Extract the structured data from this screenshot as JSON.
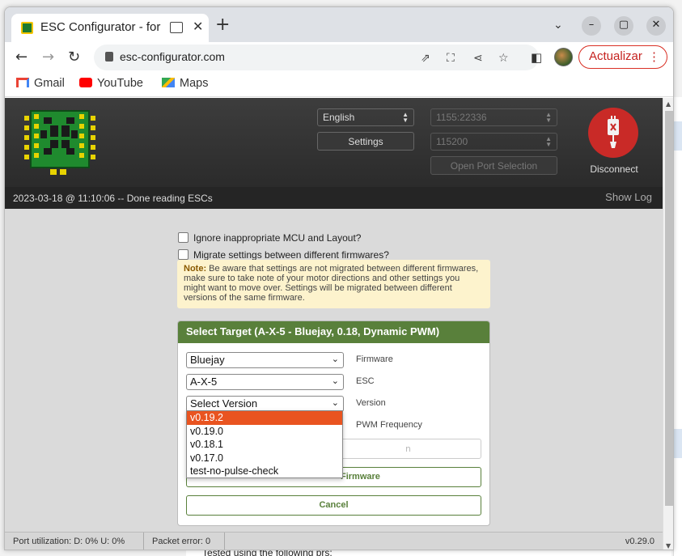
{
  "browser": {
    "tab_title": "ESC Configurator - for",
    "new_tab": "+",
    "close_tab": "✕",
    "url": "esc-configurator.com",
    "update_button": "Actualizar",
    "window_controls": {
      "minimize": "–",
      "maximize": "▢",
      "close": "✕"
    },
    "bookmarks": [
      {
        "label": "Gmail",
        "icon": "gmail-icon"
      },
      {
        "label": "YouTube",
        "icon": "youtube-icon"
      },
      {
        "label": "Maps",
        "icon": "maps-icon"
      }
    ]
  },
  "header": {
    "language": "English",
    "settings_button": "Settings",
    "port": "1155:22336",
    "baud": "115200",
    "open_port_button": "Open Port Selection",
    "disconnect_label": "Disconnect"
  },
  "log": {
    "message": "2023-03-18 @ 11:10:06 -- Done reading ESCs",
    "show_log": "Show Log"
  },
  "options": {
    "ignore_mcu": "Ignore inappropriate MCU and Layout?",
    "migrate": "Migrate settings between different firmwares?"
  },
  "note": {
    "prefix": "Note:",
    "text": "Be aware that settings are not migrated between different firmwares, make sure to take note of your motor directions and other settings you might want to move over. Settings will be migrated between different versions of the same firmware."
  },
  "target_panel": {
    "title": "Select Target (A-X-5 - Bluejay, 0.18, Dynamic PWM)",
    "firmware_value": "Bluejay",
    "firmware_label": "Firmware",
    "esc_value": "A-X-5",
    "esc_label": "ESC",
    "version_value": "Select Version",
    "version_label": "Version",
    "pwm_label": "PWM Frequency",
    "file_placeholder_fragment": "n",
    "flash_button_fragment": "Firmware",
    "cancel_button": "Cancel"
  },
  "version_dropdown": {
    "options": [
      "v0.19.2",
      "v0.19.0",
      "v0.18.1",
      "v0.17.0",
      "test-no-pulse-check"
    ],
    "highlighted": "v0.19.2"
  },
  "footer": {
    "port_utilization": "Port utilization: D: 0% U: 0%",
    "packet_error": "Packet error: 0",
    "version": "v0.29.0"
  },
  "background": {
    "bottom_text": "Tested using the following prs:"
  },
  "colors": {
    "accent_green": "#59803b",
    "disconnect_red": "#c92a27",
    "dropdown_highlight": "#e95420",
    "note_bg": "#fdf3cd"
  }
}
